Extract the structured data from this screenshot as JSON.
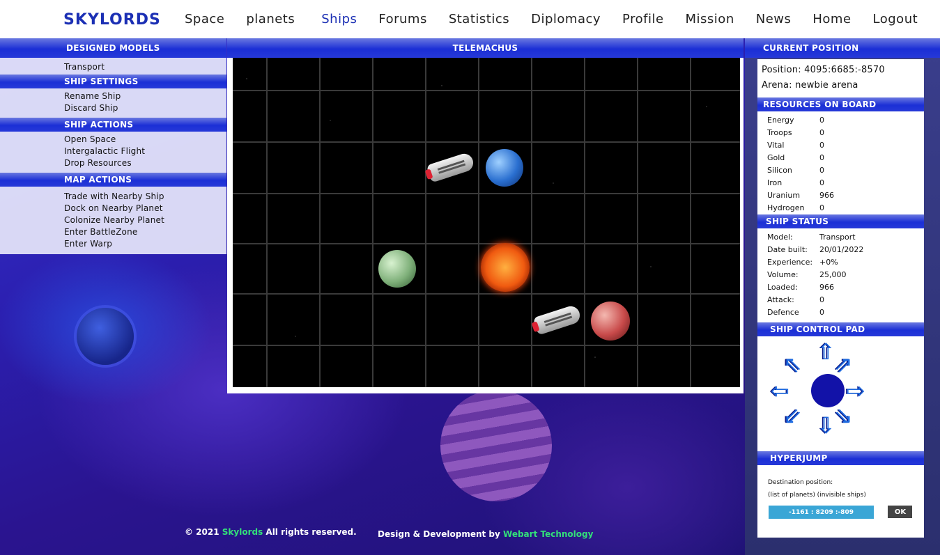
{
  "header": {
    "logo": "SKYLORDS",
    "nav": [
      "Space",
      "planets",
      "Ships",
      "Forums",
      "Statistics",
      "Diplomacy",
      "Profile",
      "Mission",
      "News",
      "Home",
      "Logout"
    ],
    "active_nav": "Ships"
  },
  "left": {
    "designed_models_title": "DESIGNED MODELS",
    "models": [
      "Transport"
    ],
    "ship_settings_title": "SHIP SETTINGS",
    "ship_settings": [
      "Rename Ship",
      "Discard Ship"
    ],
    "ship_actions_title": "SHIP ACTIONS",
    "ship_actions": [
      "Open Space",
      "Intergalactic Flight",
      "Drop Resources"
    ],
    "map_actions_title": "MAP ACTIONS",
    "map_actions": [
      "Trade with Nearby Ship",
      "Dock on Nearby Planet",
      "Colonize Nearby Planet",
      "Enter BattleZone",
      "Enter Warp"
    ]
  },
  "center": {
    "title": "TELEMACHUS",
    "grid": {
      "cols": 10,
      "rows": 7
    },
    "objects": [
      {
        "kind": "ship",
        "col": 3,
        "row": 1
      },
      {
        "kind": "planet",
        "color": "blue",
        "col": 4,
        "row": 1
      },
      {
        "kind": "planet",
        "color": "green",
        "col": 2,
        "row": 3
      },
      {
        "kind": "planet",
        "color": "sun",
        "col": 4,
        "row": 3
      },
      {
        "kind": "ship",
        "col": 5,
        "row": 4
      },
      {
        "kind": "planet",
        "color": "red",
        "col": 6,
        "row": 4
      }
    ]
  },
  "right": {
    "current_position_title": "CURRENT POSITION",
    "position": "Position: 4095:6685:-8570",
    "arena": "Arena: newbie arena",
    "resources_title": "RESOURCES ON BOARD",
    "resources": [
      {
        "name": "Energy",
        "value": "0"
      },
      {
        "name": "Troops",
        "value": "0"
      },
      {
        "name": "Vital",
        "value": "0"
      },
      {
        "name": "Gold",
        "value": "0"
      },
      {
        "name": "Silicon",
        "value": "0"
      },
      {
        "name": "Iron",
        "value": "0"
      },
      {
        "name": "Uranium",
        "value": "966"
      },
      {
        "name": "Hydrogen",
        "value": "0"
      }
    ],
    "ship_status_title": "SHIP STATUS",
    "ship_status": [
      {
        "name": "Model:",
        "value": "Transport"
      },
      {
        "name": "Date built:",
        "value": "20/01/2022"
      },
      {
        "name": "Experience:",
        "value": "+0%"
      },
      {
        "name": "Volume:",
        "value": "25,000"
      },
      {
        "name": "Loaded:",
        "value": "966"
      },
      {
        "name": "Attack:",
        "value": "0"
      },
      {
        "name": "Defence",
        "value": "0"
      }
    ],
    "control_pad_title": "SHIP CONTROL PAD",
    "hyperjump_title": "HYPERJUMP",
    "destination_label": "Destination position:",
    "destination_hint": "(list of planets) (invisible ships)",
    "destination_value": "-1161 : 8209 :-809",
    "ok_label": "OK"
  },
  "footer": {
    "copyright_prefix": "© 2021",
    "brand": "Skylords",
    "rights": "All rights reserved.",
    "design_prefix": "Design & Development by",
    "developer": "Webart Technology"
  },
  "colors": {
    "accent": "#1b2fb4",
    "bar": "#2638d8",
    "footer_link": "#33e07a",
    "input": "#3aa6d6"
  }
}
